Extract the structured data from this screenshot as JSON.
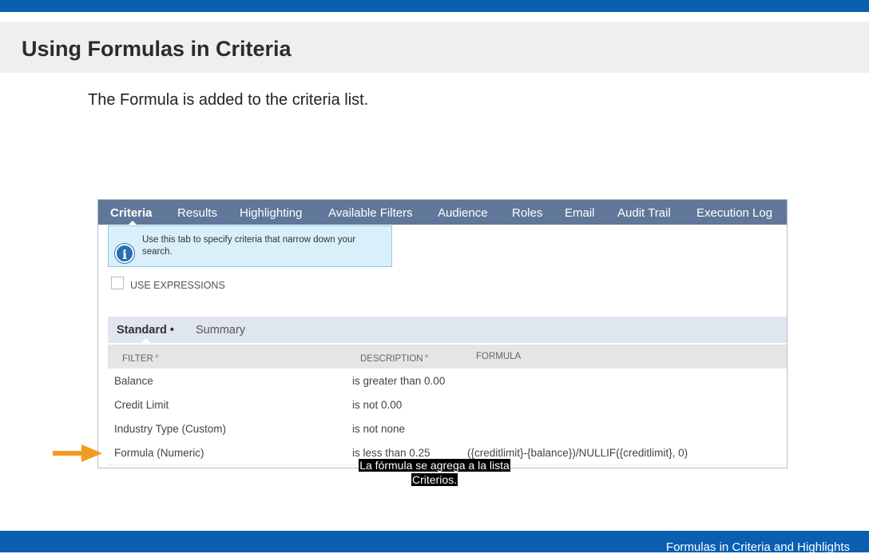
{
  "slide": {
    "title": "Using Formulas in Criteria",
    "body": "The Formula is added to the criteria list."
  },
  "tabs": [
    {
      "label": "Criteria",
      "active": true
    },
    {
      "label": "Results"
    },
    {
      "label": "Highlighting"
    },
    {
      "label": "Available Filters"
    },
    {
      "label": "Audience"
    },
    {
      "label": "Roles"
    },
    {
      "label": "Email"
    },
    {
      "label": "Audit Trail"
    },
    {
      "label": "Execution Log"
    }
  ],
  "info": {
    "icon": "info-icon",
    "text": "Use this tab to specify criteria that narrow down your search."
  },
  "use_expressions": {
    "label": "USE EXPRESSIONS",
    "checked": false
  },
  "subtabs": {
    "standard": "Standard",
    "standard_dot": "•",
    "summary": "Summary"
  },
  "columns": {
    "filter": "FILTER",
    "description": "DESCRIPTION",
    "formula": "FORMULA",
    "required_mark": "*"
  },
  "rows": [
    {
      "filter": "Balance",
      "description": "is greater than 0.00",
      "formula": ""
    },
    {
      "filter": "Credit Limit",
      "description": "is not 0.00",
      "formula": ""
    },
    {
      "filter": "Industry Type (Custom)",
      "description": "is not none",
      "formula": ""
    },
    {
      "filter": "Formula (Numeric)",
      "description": "is less than 0.25",
      "formula": "({creditlimit}-{balance})/NULLIF({creditlimit}, 0)"
    }
  ],
  "caption": {
    "line1": "La fórmula se agrega a la lista",
    "line2": "Criterios."
  },
  "footer": "Formulas in Criteria and Highlights",
  "colors": {
    "brand_blue": "#0a5fb0",
    "tab_bar": "#607799",
    "arrow": "#f39c1f",
    "required": "#e07a2e"
  }
}
